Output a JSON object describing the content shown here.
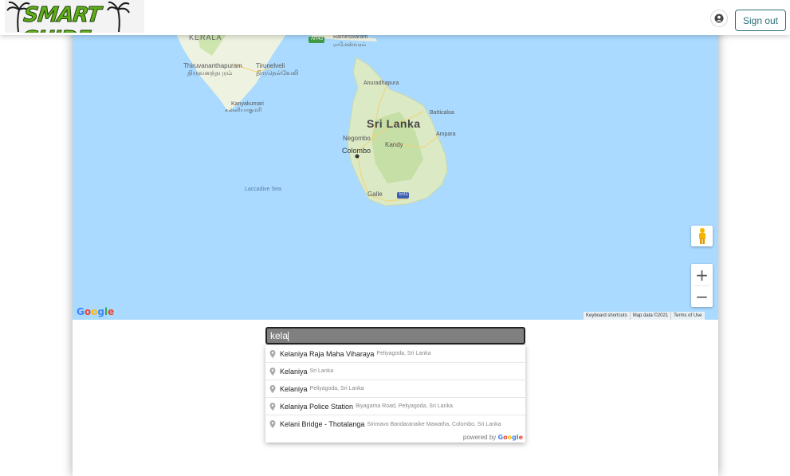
{
  "header": {
    "logo_text": "SMART GUIDE",
    "signout_label": "Sign out"
  },
  "map": {
    "labels": {
      "kerala": "KERALA",
      "thiruvananthapuram": "Thiruvananthapuram",
      "thiruvananthapuram_ta": "திருவனந்தபுரம்",
      "tirunelveli": "Tirunelveli",
      "tirunelveli_ta": "திருநெல்வேலி",
      "kanyakumari": "Kanyakumari",
      "kanyakumari_ta": "கன்னியாகுமரி",
      "rameswaram": "Rameswaram",
      "rameswaram_ta": "ராமேஸ்வரம்",
      "anuradhapura": "Anuradhapura",
      "sri_lanka": "Sri Lanka",
      "batticaloa": "Batticaloa",
      "ampara": "Ampara",
      "negombo": "Negombo",
      "kandy": "Kandy",
      "colombo": "Colombo",
      "laccadive_sea": "Laccadive Sea",
      "galle": "Galle",
      "ah43": "AH43",
      "e01": "E01"
    },
    "google": "Google",
    "footer": {
      "shortcuts": "Keyboard shortcuts",
      "map_data": "Map data ©2021",
      "terms": "Terms of Use"
    },
    "zoom_in": "+",
    "zoom_out": "−"
  },
  "search": {
    "value": "kela"
  },
  "suggestions": [
    {
      "main": "Kelaniya Raja Maha Viharaya",
      "sub": "Peliyagoda, Sri Lanka"
    },
    {
      "main": "Kelaniya",
      "sub": "Sri Lanka"
    },
    {
      "main": "Kelaniya",
      "sub": "Peliyagoda, Sri Lanka"
    },
    {
      "main": "Kelaniya Police Station",
      "sub": "Biyagama Road, Peliyagoda, Sri Lanka"
    },
    {
      "main": "Kelani Bridge - Thotalanga",
      "sub": "Sirimavo Bandaranaike Mawatha, Colombo, Sri Lanka"
    }
  ],
  "powered_by": "powered by",
  "powered_google": "Google",
  "colors": {
    "sea": "#aadaff",
    "land": "#e8efd9",
    "accent": "#2e6f7a",
    "logo_green": "#5fae1a"
  }
}
